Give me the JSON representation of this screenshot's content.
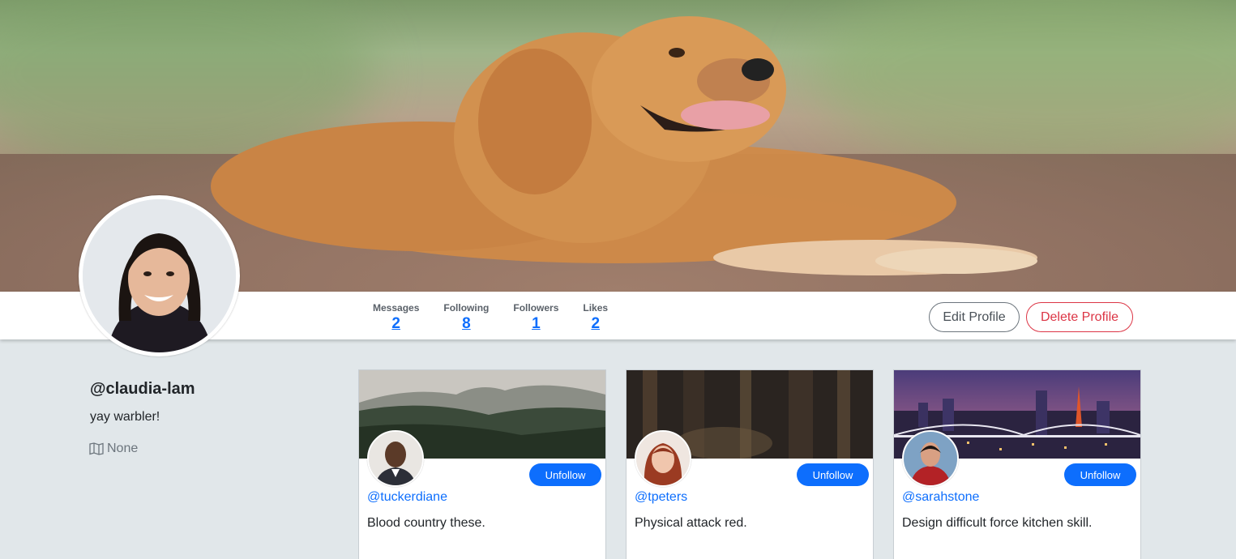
{
  "profile": {
    "username": "@claudia-lam",
    "bio": "yay warbler!",
    "location": "None"
  },
  "stats": [
    {
      "label": "Messages",
      "value": "2"
    },
    {
      "label": "Following",
      "value": "8"
    },
    {
      "label": "Followers",
      "value": "1"
    },
    {
      "label": "Likes",
      "value": "2"
    }
  ],
  "actions": {
    "edit_label": "Edit Profile",
    "delete_label": "Delete Profile"
  },
  "cards": [
    {
      "handle": "@tuckerdiane",
      "bio": "Blood country these.",
      "button_label": "Unfollow"
    },
    {
      "handle": "@tpeters",
      "bio": "Physical attack red.",
      "button_label": "Unfollow"
    },
    {
      "handle": "@sarahstone",
      "bio": "Design difficult force kitchen skill.",
      "button_label": "Unfollow"
    }
  ],
  "colors": {
    "primary": "#0d6efd",
    "danger": "#dc3545",
    "page_bg": "#e1e7ea"
  }
}
